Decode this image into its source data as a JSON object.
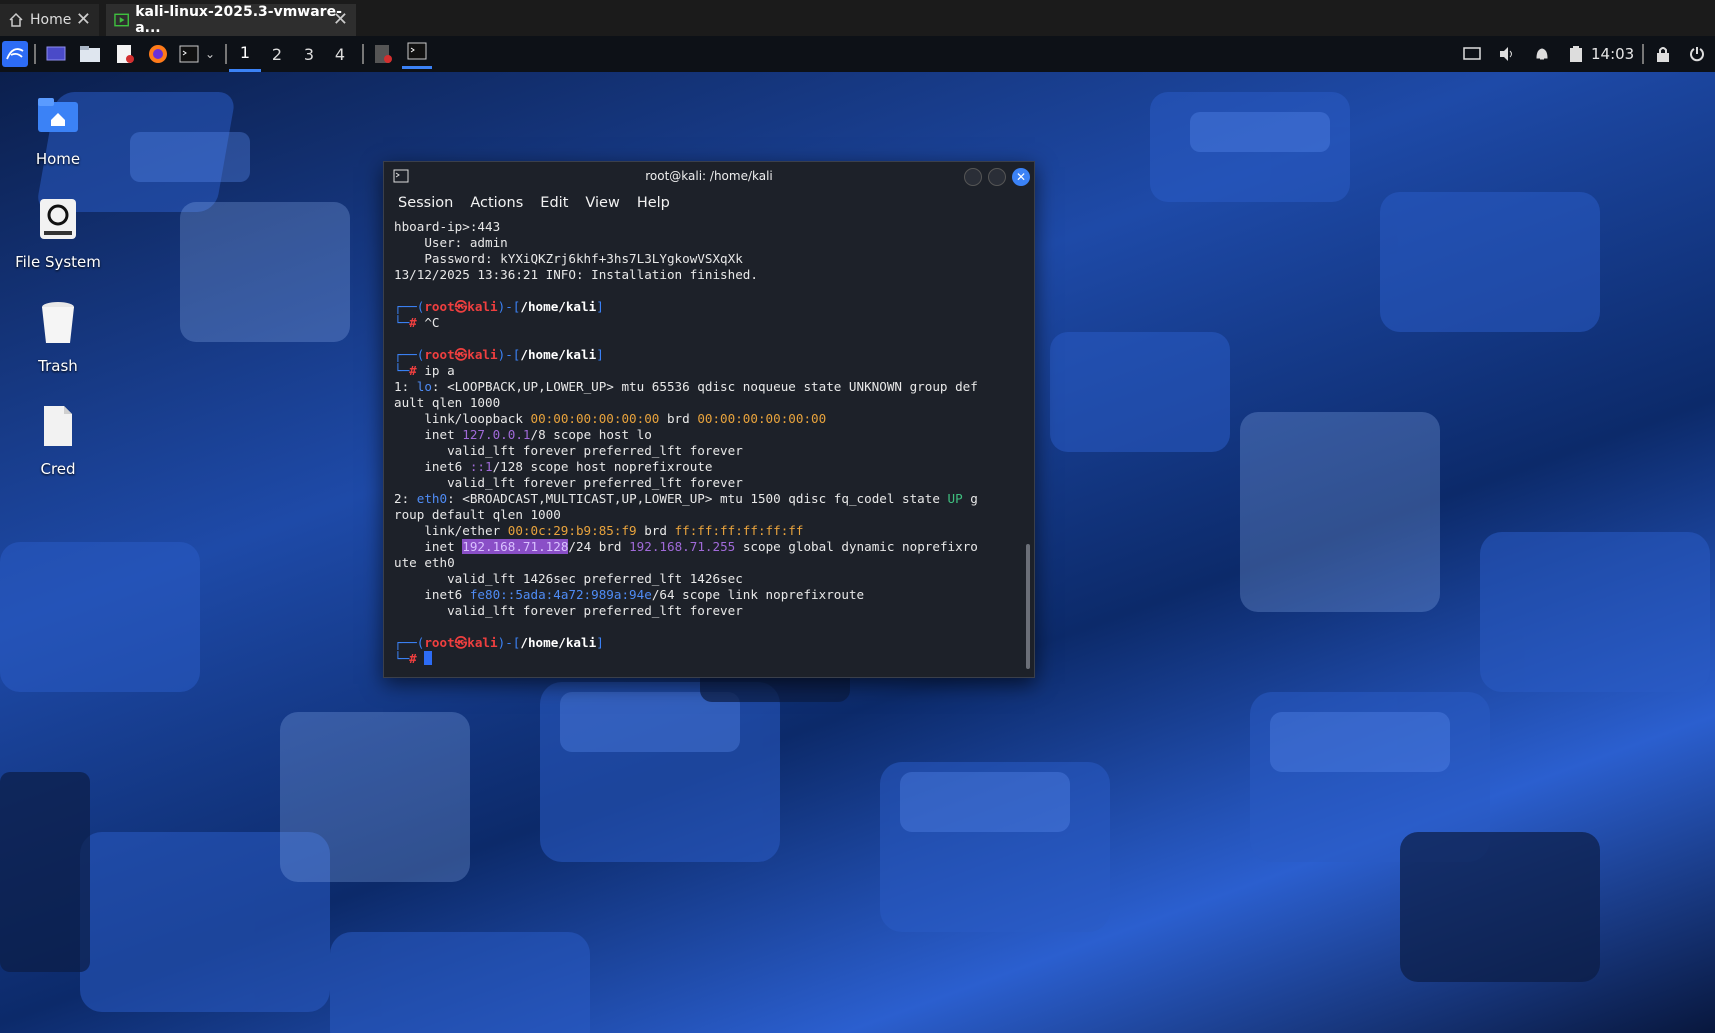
{
  "vmware": {
    "tabs": [
      {
        "label": "Home"
      },
      {
        "label": "kali-linux-2025.3-vmware-a..."
      }
    ]
  },
  "panel": {
    "workspaces": [
      "1",
      "2",
      "3",
      "4"
    ],
    "active_workspace": "1",
    "clock": "14:03"
  },
  "desktop": {
    "icons": [
      {
        "label": "Home",
        "icon": "home-folder-icon"
      },
      {
        "label": "File System",
        "icon": "drive-icon"
      },
      {
        "label": "Trash",
        "icon": "trash-icon"
      },
      {
        "label": "Cred",
        "icon": "file-icon"
      }
    ]
  },
  "terminal": {
    "title": "root@kali: /home/kali",
    "menu": [
      "Session",
      "Actions",
      "Edit",
      "View",
      "Help"
    ],
    "lines": [
      "hboard-ip>:443",
      "    User: admin",
      "    Password: kYXiQKZrj6khf+3hs7L3LYgkowVSXqXk",
      "13/12/2025 13:36:21 INFO: Installation finished.",
      "",
      "┌──(root㉿kali)-[/home/kali]",
      "└─# ^C",
      "",
      "┌──(root㉿kali)-[/home/kali]",
      "└─# ip a",
      "1: lo: <LOOPBACK,UP,LOWER_UP> mtu 65536 qdisc noqueue state UNKNOWN group def",
      "ault qlen 1000",
      "    link/loopback 00:00:00:00:00:00 brd 00:00:00:00:00:00",
      "    inet 127.0.0.1/8 scope host lo",
      "       valid_lft forever preferred_lft forever",
      "    inet6 ::1/128 scope host noprefixroute",
      "       valid_lft forever preferred_lft forever",
      "2: eth0: <BROADCAST,MULTICAST,UP,LOWER_UP> mtu 1500 qdisc fq_codel state UP g",
      "roup default qlen 1000",
      "    link/ether 00:0c:29:b9:85:f9 brd ff:ff:ff:ff:ff:ff",
      "    inet 192.168.71.128/24 brd 192.168.71.255 scope global dynamic noprefixro",
      "ute eth0",
      "       valid_lft 1426sec preferred_lft 1426sec",
      "    inet6 fe80::5ada:4a72:989a:94e/64 scope link noprefixroute",
      "       valid_lft forever preferred_lft forever",
      "",
      "┌──(root㉿kali)-[/home/kali]",
      "└─# "
    ]
  },
  "colors": {
    "accent": "#3b82f6",
    "prompt_red": "#ef3f3f",
    "selection": "#8a4fc7"
  }
}
